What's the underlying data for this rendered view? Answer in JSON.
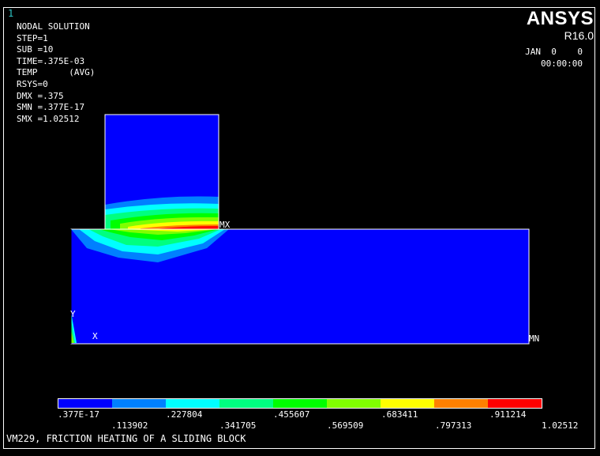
{
  "window_number": "1",
  "brand": "ANSYS",
  "version": "R16.0",
  "date": "JAN  0    0",
  "time": "00:00:00",
  "info_lines": [
    "NODAL SOLUTION",
    "",
    "STEP=1",
    "SUB =10",
    "TIME=.375E-03",
    "TEMP      (AVG)",
    "RSYS=0",
    "DMX =.375",
    "SMN =.377E-17",
    "SMX =1.02512"
  ],
  "markers": {
    "max": "MX",
    "min": "MN",
    "axis_y": "Y",
    "axis_x": "X"
  },
  "legend": {
    "colors": [
      "#0000ff",
      "#0080ff",
      "#00ffff",
      "#00ff80",
      "#00ff00",
      "#80ff00",
      "#ffff00",
      "#ff8000",
      "#ff0000"
    ],
    "top_labels": [
      ".377E-17",
      ".227804",
      ".455607",
      ".683411",
      ".911214"
    ],
    "bottom_labels": [
      ".113902",
      ".341705",
      ".569509",
      ".797313",
      "1.02512"
    ]
  },
  "title": "VM229, FRICTION HEATING OF A SLIDING BLOCK"
}
